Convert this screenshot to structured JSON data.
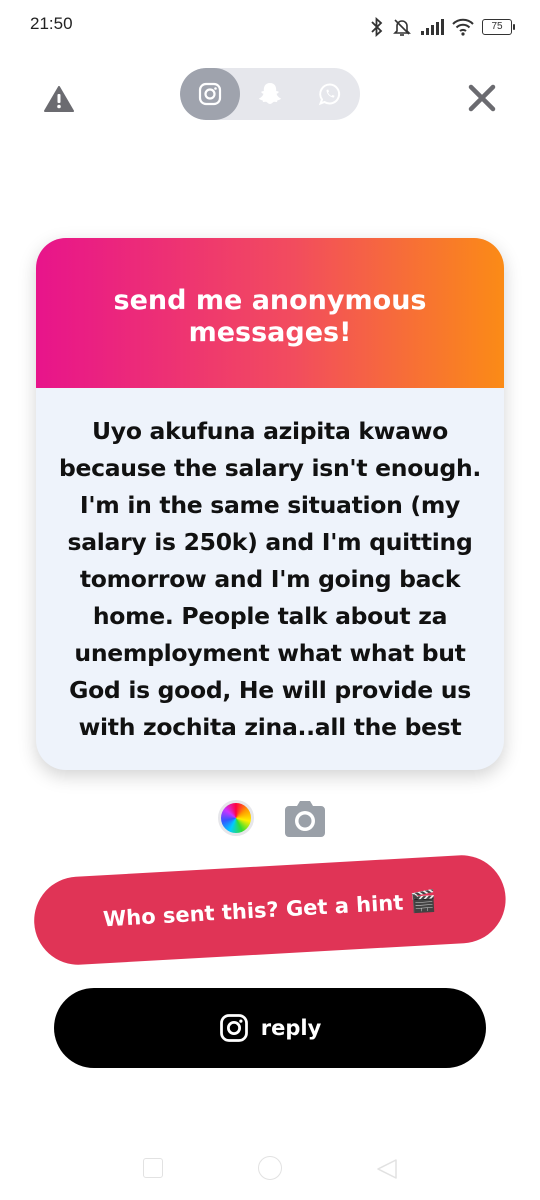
{
  "status_bar": {
    "time": "21:50",
    "battery": "75",
    "icons": [
      "bluetooth-icon",
      "bell-muted-icon",
      "signal-icon",
      "wifi-icon",
      "battery-icon"
    ]
  },
  "top_bar": {
    "platforms": [
      {
        "icon": "instagram-icon",
        "active": true
      },
      {
        "icon": "snapchat-icon",
        "active": false
      },
      {
        "icon": "whatsapp-icon",
        "active": false
      }
    ],
    "left_icon": "warning-icon",
    "right_icon": "close-icon"
  },
  "card": {
    "title": "send me anonymous messages!",
    "message": "Uyo akufuna azipita kwawo because the salary isn't enough. I'm in the same situation (my salary is 250k) and I'm quitting tomorrow and I'm going back home. People talk about za unemployment what what but God is good, He will provide us with zochita zina..all the best",
    "gradient": [
      "#e8148b",
      "#fb8b16"
    ]
  },
  "tools": {
    "color_icon": "color-wheel-icon",
    "camera_icon": "camera-icon"
  },
  "actions": {
    "hint_label": "Who sent this? Get a hint 🎬",
    "reply_label": "reply",
    "hint_color": "#e03456",
    "reply_color": "#000000"
  }
}
